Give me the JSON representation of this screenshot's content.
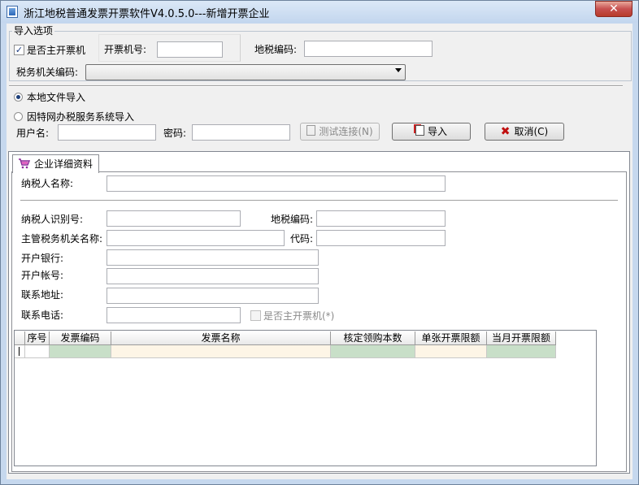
{
  "window": {
    "title": "浙江地税普通发票开票软件V4.0.5.0---新增开票企业",
    "close_symbol": "✕"
  },
  "import_options": {
    "legend": "导入选项",
    "is_main_invoice_machine": {
      "label": "是否主开票机",
      "checked": true,
      "mark": "✓"
    },
    "machine_no": {
      "label": "开票机号:",
      "value": ""
    },
    "local_tax_code": {
      "label": "地税编码:",
      "value": ""
    },
    "tax_authority_code": {
      "label": "税务机关编码:",
      "value": ""
    },
    "local_file_import": {
      "label": "本地文件导入",
      "selected": true
    },
    "online_import": {
      "label": "因特网办税服务系统导入",
      "selected": false
    },
    "username": {
      "label": "用户名:",
      "value": ""
    },
    "password": {
      "label": "密码:",
      "value": ""
    },
    "test_connection_button": "测试连接(N)",
    "import_button": "导入",
    "cancel_button": "取消(C)"
  },
  "tab": {
    "label": "企业详细资料"
  },
  "details": {
    "taxpayer_name": {
      "label": "纳税人名称:",
      "value": ""
    },
    "taxpayer_id": {
      "label": "纳税人识别号:",
      "value": ""
    },
    "local_tax_code": {
      "label": "地税编码:",
      "value": ""
    },
    "authority_name": {
      "label": "主管税务机关名称:",
      "value": ""
    },
    "code": {
      "label": "代码:",
      "value": ""
    },
    "bank": {
      "label": "开户银行:",
      "value": ""
    },
    "account": {
      "label": "开户帐号:",
      "value": ""
    },
    "address": {
      "label": "联系地址:",
      "value": ""
    },
    "phone": {
      "label": "联系电话:",
      "value": ""
    },
    "main_machine_checkbox": {
      "label": "是否主开票机(*)",
      "checked": false
    }
  },
  "grid": {
    "columns": [
      "序号",
      "发票编码",
      "发票名称",
      "核定领购本数",
      "单张开票限额",
      "当月开票限额"
    ],
    "rows": []
  }
}
